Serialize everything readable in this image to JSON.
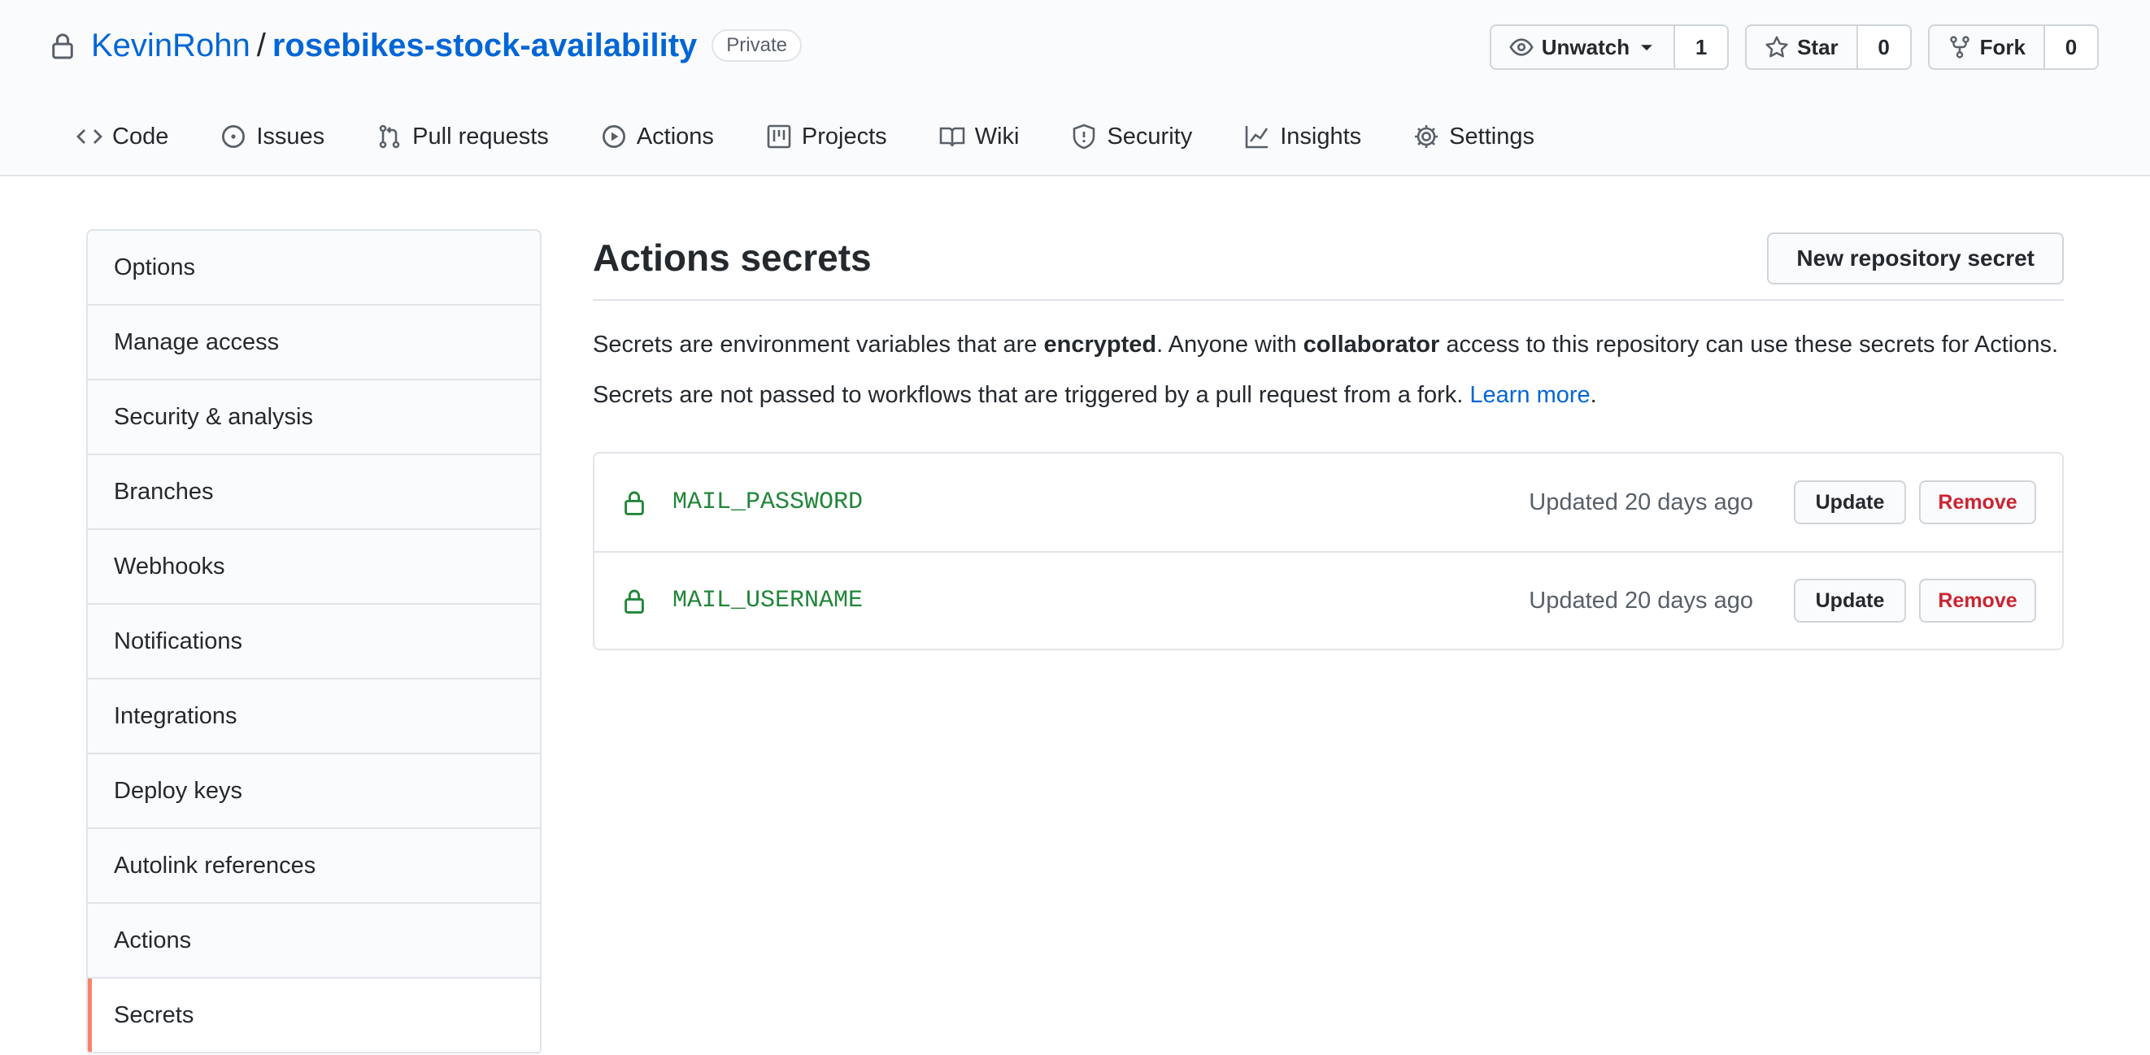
{
  "repo": {
    "owner": "KevinRohn",
    "separator": "/",
    "name": "rosebikes-stock-availability",
    "visibility": "Private"
  },
  "head_actions": {
    "watch": {
      "label": "Unwatch",
      "count": "1"
    },
    "star": {
      "label": "Star",
      "count": "0"
    },
    "fork": {
      "label": "Fork",
      "count": "0"
    }
  },
  "tabs": [
    {
      "label": "Code",
      "icon": "code-icon"
    },
    {
      "label": "Issues",
      "icon": "issue-icon"
    },
    {
      "label": "Pull requests",
      "icon": "pull-request-icon"
    },
    {
      "label": "Actions",
      "icon": "play-icon"
    },
    {
      "label": "Projects",
      "icon": "project-icon"
    },
    {
      "label": "Wiki",
      "icon": "book-icon"
    },
    {
      "label": "Security",
      "icon": "shield-icon"
    },
    {
      "label": "Insights",
      "icon": "graph-icon"
    },
    {
      "label": "Settings",
      "icon": "gear-icon"
    }
  ],
  "sidebar": {
    "items": [
      {
        "label": "Options"
      },
      {
        "label": "Manage access"
      },
      {
        "label": "Security & analysis"
      },
      {
        "label": "Branches"
      },
      {
        "label": "Webhooks"
      },
      {
        "label": "Notifications"
      },
      {
        "label": "Integrations"
      },
      {
        "label": "Deploy keys"
      },
      {
        "label": "Autolink references"
      },
      {
        "label": "Actions"
      },
      {
        "label": "Secrets",
        "active": true
      }
    ]
  },
  "main": {
    "title": "Actions secrets",
    "new_button": "New repository secret",
    "desc1": {
      "p1": "Secrets are environment variables that are ",
      "b1": "encrypted",
      "p2": ". Anyone with ",
      "b2": "collaborator",
      "p3": " access to this repository can use these secrets for Actions."
    },
    "desc2": {
      "p1": "Secrets are not passed to workflows that are triggered by a pull request from a fork. ",
      "link": "Learn more",
      "p2": "."
    },
    "secrets": [
      {
        "name": "MAIL_PASSWORD",
        "updated": "Updated 20 days ago",
        "update_label": "Update",
        "remove_label": "Remove"
      },
      {
        "name": "MAIL_USERNAME",
        "updated": "Updated 20 days ago",
        "update_label": "Update",
        "remove_label": "Remove"
      }
    ]
  },
  "colors": {
    "link": "#0366d6",
    "secret_name": "#22863a",
    "remove": "#cb2431",
    "active_marker": "#f9826c"
  }
}
